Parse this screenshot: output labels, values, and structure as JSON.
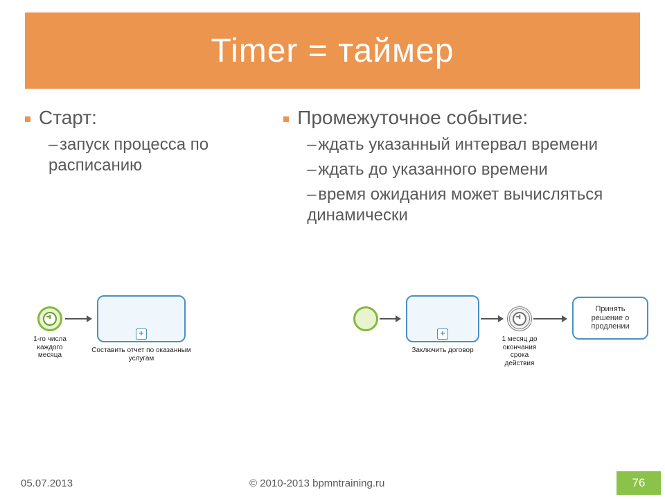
{
  "title": "Timer = таймер",
  "left": {
    "heading": "Старт:",
    "items": [
      "запуск процесса по расписанию"
    ]
  },
  "right": {
    "heading": "Промежуточное событие:",
    "items": [
      "ждать указанный интервал времени",
      "ждать до указанного времени",
      "время ожидания может вычисляться динамически"
    ]
  },
  "diagramA": {
    "startLabel": "1-го числа\nкаждого\nмесяца",
    "taskLabel": "Составить отчет по оказанным услугам"
  },
  "diagramB": {
    "task1Label": "Заключить договор",
    "interLabel": "1 месяц до\nокончания\nсрока\nдействия",
    "task2Label": "Принять\nрешение о\nпродлении"
  },
  "footer": {
    "date": "05.07.2013",
    "copyright": "© 2010-2013 bpmntraining.ru",
    "page": "76"
  }
}
